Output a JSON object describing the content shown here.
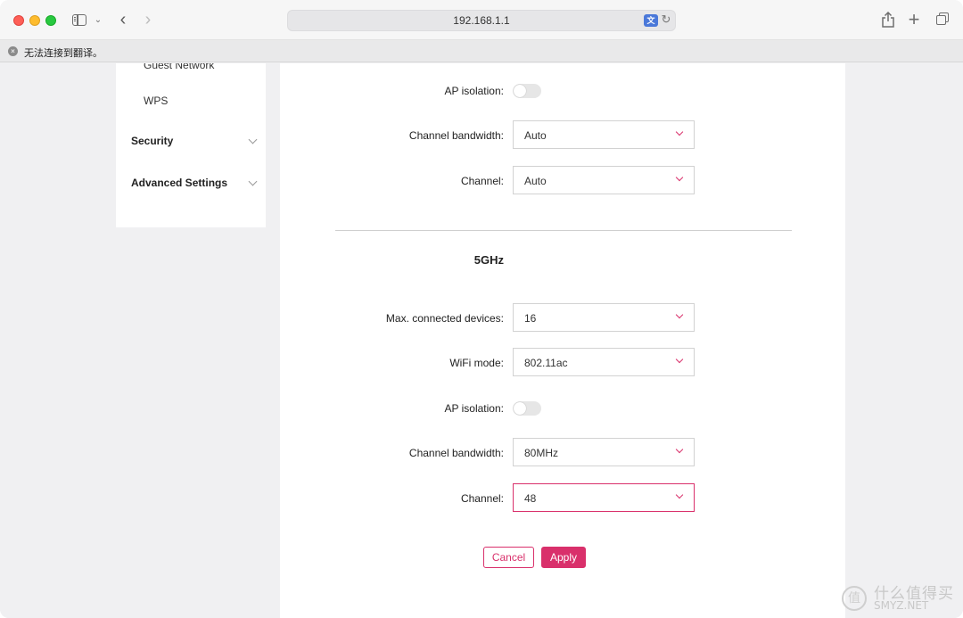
{
  "browser": {
    "url": "192.168.1.1",
    "notice": "无法连接到翻译。"
  },
  "sidebar": {
    "items": [
      {
        "label": "Guest Network"
      },
      {
        "label": "WPS"
      }
    ],
    "sections": [
      {
        "label": "Security"
      },
      {
        "label": "Advanced Settings"
      }
    ]
  },
  "band24": {
    "ap_isolation_label": "AP isolation:",
    "ap_isolation_on": false,
    "channel_bandwidth_label": "Channel bandwidth:",
    "channel_bandwidth_value": "Auto",
    "channel_label": "Channel:",
    "channel_value": "Auto"
  },
  "band5": {
    "title": "5GHz",
    "max_devices_label": "Max. connected devices:",
    "max_devices_value": "16",
    "wifi_mode_label": "WiFi mode:",
    "wifi_mode_value": "802.11ac",
    "ap_isolation_label": "AP isolation:",
    "ap_isolation_on": false,
    "channel_bandwidth_label": "Channel bandwidth:",
    "channel_bandwidth_value": "80MHz",
    "channel_label": "Channel:",
    "channel_value": "48"
  },
  "actions": {
    "cancel": "Cancel",
    "apply": "Apply"
  },
  "watermark": {
    "logo": "值",
    "text": "什么值得买",
    "subtext": "SMYZ.NET"
  },
  "colors": {
    "accent": "#d9306b"
  }
}
